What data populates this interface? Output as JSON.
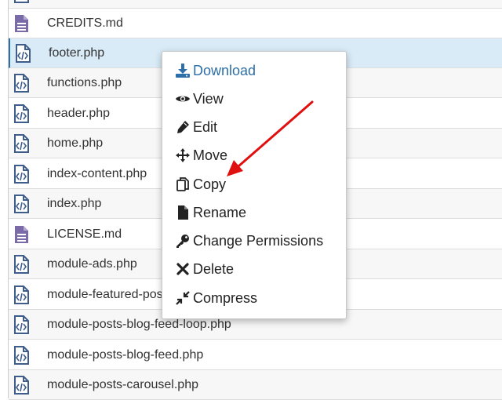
{
  "files": [
    {
      "name": "",
      "type": "php"
    },
    {
      "name": "CREDITS.md",
      "type": "text"
    },
    {
      "name": "footer.php",
      "type": "php"
    },
    {
      "name": "functions.php",
      "type": "php"
    },
    {
      "name": "header.php",
      "type": "php"
    },
    {
      "name": "home.php",
      "type": "php"
    },
    {
      "name": "index-content.php",
      "type": "php"
    },
    {
      "name": "index.php",
      "type": "php"
    },
    {
      "name": "LICENSE.md",
      "type": "text"
    },
    {
      "name": "module-ads.php",
      "type": "php"
    },
    {
      "name": "module-featured-posts.php",
      "type": "php"
    },
    {
      "name": "module-posts-blog-feed-loop.php",
      "type": "php"
    },
    {
      "name": "module-posts-blog-feed.php",
      "type": "php"
    },
    {
      "name": "module-posts-carousel.php",
      "type": "php"
    }
  ],
  "selected_file": "footer.php",
  "context_menu": {
    "items": [
      {
        "label": "Download",
        "icon": "download-icon"
      },
      {
        "label": "View",
        "icon": "eye-icon"
      },
      {
        "label": "Edit",
        "icon": "pencil-icon"
      },
      {
        "label": "Move",
        "icon": "move-arrows-icon"
      },
      {
        "label": "Copy",
        "icon": "copy-icon"
      },
      {
        "label": "Rename",
        "icon": "file-icon"
      },
      {
        "label": "Change Permissions",
        "icon": "key-icon"
      },
      {
        "label": "Delete",
        "icon": "x-icon"
      },
      {
        "label": "Compress",
        "icon": "compress-icon"
      }
    ]
  },
  "colors": {
    "accent": "#2d6fa8",
    "php_icon": "#3f5d8a",
    "text_icon": "#7b6aa8",
    "annotation_arrow": "#e01010"
  }
}
